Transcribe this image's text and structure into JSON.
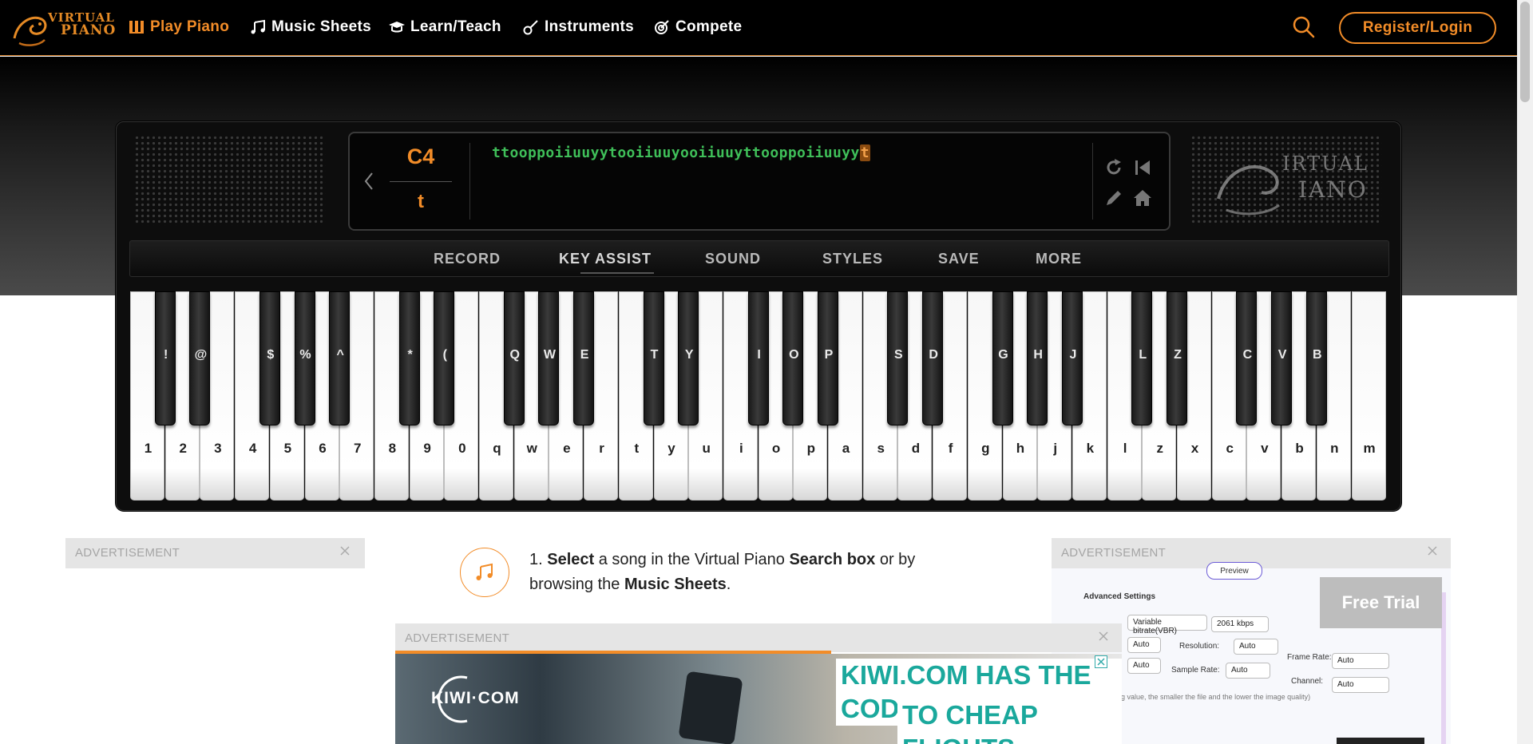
{
  "nav": {
    "logo_line1": "VIRTUAL",
    "logo_line2": "PIANO",
    "items": [
      {
        "label": "Play Piano",
        "icon": "piano-icon"
      },
      {
        "label": "Music Sheets",
        "icon": "music-notes-icon"
      },
      {
        "label": "Learn/Teach",
        "icon": "graduation-cap-icon"
      },
      {
        "label": "Instruments",
        "icon": "guitar-icon"
      },
      {
        "label": "Compete",
        "icon": "target-icon"
      }
    ],
    "login_label": "Register/Login"
  },
  "display": {
    "note": "C4",
    "key": "t",
    "sheet": "ttooppoiiuuyytooiiuuyooiiuuyttooppoiiuuyy",
    "cursor_char": "t"
  },
  "menu": [
    "RECORD",
    "KEY ASSIST",
    "SOUND",
    "STYLES",
    "SAVE",
    "MORE"
  ],
  "white_keys": [
    "1",
    "2",
    "3",
    "4",
    "5",
    "6",
    "7",
    "8",
    "9",
    "0",
    "q",
    "w",
    "e",
    "r",
    "t",
    "y",
    "u",
    "i",
    "o",
    "p",
    "a",
    "s",
    "d",
    "f",
    "g",
    "h",
    "j",
    "k",
    "l",
    "z",
    "x",
    "c",
    "v",
    "b",
    "n",
    "m"
  ],
  "black_keys": [
    "!",
    "@",
    "$",
    "%",
    "^",
    "*",
    "(",
    "Q",
    "W",
    "E",
    "T",
    "Y",
    "I",
    "O",
    "P",
    "S",
    "D",
    "G",
    "H",
    "J",
    "L",
    "Z",
    "C",
    "V",
    "B"
  ],
  "ads": {
    "label": "ADVERTISEMENT",
    "right": {
      "preview": "Preview",
      "advanced": "Advanced Settings",
      "mode": "Variable bitrate(VBR)",
      "bitrate": "2061 kbps",
      "auto": "Auto",
      "resolution": "Resolution:",
      "frame_rate": "Frame Rate:",
      "sample_rate": "Sample Rate:",
      "channel": "Channel:",
      "note": "ing value,  the smaller the file and the lower the image quality)",
      "free_trial": "Free Trial"
    },
    "bottom": {
      "brand": "KIWI·COM",
      "slogan1": "KIWI.COM HAS THE CODE",
      "slogan2": "TO CHEAP FLIGHTS"
    }
  },
  "step": {
    "n": "1.",
    "w1": "Select",
    "t1": " a song in the Virtual Piano ",
    "w2": "Search box",
    "t2": " or by browsing the ",
    "w3": "Music Sheets",
    "t3": "."
  },
  "colors": {
    "accent": "#f28c28",
    "sheet_green": "#3fbf59"
  }
}
